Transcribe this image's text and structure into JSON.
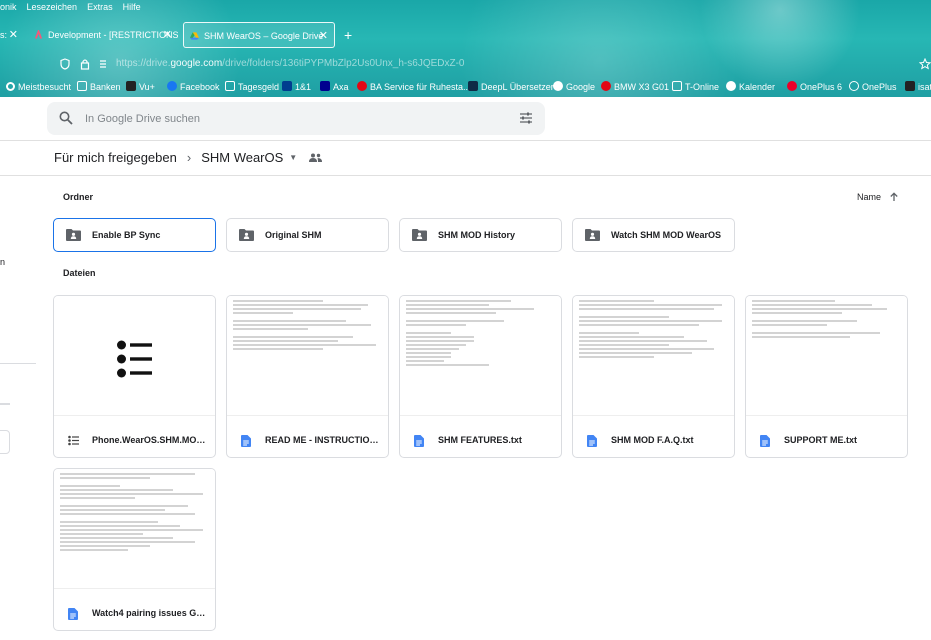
{
  "browser": {
    "menu": [
      "onik",
      "Lesezeichen",
      "Extras",
      "Hilfe"
    ],
    "tabs": [
      {
        "label": "s: "
      },
      {
        "label": "Development - [RESTRICTIONS"
      },
      {
        "label": "SHM WearOS – Google Drive"
      }
    ],
    "url_prefix": "https://drive.",
    "url_domain": "google.com",
    "url_rest": "/drive/folders/136tiPYPMbZlp2Us0Unx_h-s6JQEDxZ-0",
    "bookmarks": [
      {
        "label": "Meistbesucht",
        "color": "#ffffff"
      },
      {
        "label": "Banken",
        "color": "#ffffff"
      },
      {
        "label": "Vu+",
        "color": "#222222"
      },
      {
        "label": "Facebook",
        "color": "#1877f2"
      },
      {
        "label": "Tagesgeld",
        "color": "#ffffff"
      },
      {
        "label": "1&1",
        "color": "#003d8f"
      },
      {
        "label": "Axa",
        "color": "#00008f"
      },
      {
        "label": "BA Service für Ruhesta...",
        "color": "#e30613"
      },
      {
        "label": "DeepL Übersetzer",
        "color": "#0f2b46"
      },
      {
        "label": "Google",
        "color": "#4285f4"
      },
      {
        "label": "BMW X3 G01",
        "color": "#e30613"
      },
      {
        "label": "T-Online",
        "color": "#ffffff"
      },
      {
        "label": "Kalender",
        "color": "#4285f4"
      },
      {
        "label": "OnePlus 6",
        "color": "#eb0029"
      },
      {
        "label": "OnePlus",
        "color": "#ffffff"
      },
      {
        "label": "isat",
        "color": "#222222"
      }
    ]
  },
  "search": {
    "placeholder": "In Google Drive suchen"
  },
  "sidebar": {
    "fragment": "n"
  },
  "breadcrumb": {
    "parent": "Für mich freigegeben",
    "current": "SHM WearOS"
  },
  "sections": {
    "folders": "Ordner",
    "files": "Dateien",
    "sort": "Name"
  },
  "folders": [
    {
      "label": "Enable BP Sync"
    },
    {
      "label": "Original SHM"
    },
    {
      "label": "SHM MOD History"
    },
    {
      "label": "Watch SHM MOD WearOS"
    }
  ],
  "files": [
    {
      "label": "Phone.WearOS.SHM.MOD...."
    },
    {
      "label": "READ ME - INSTRUCTIONS..."
    },
    {
      "label": "SHM FEATURES.txt"
    },
    {
      "label": "SHM MOD F.A.Q.txt"
    },
    {
      "label": "SUPPORT ME.txt"
    },
    {
      "label": "Watch4 pairing issues Gal..."
    }
  ],
  "colors": {
    "accent": "#1a73e8",
    "doc_icon": "#4285f4",
    "chrome_teal": "#1fa5a7"
  }
}
